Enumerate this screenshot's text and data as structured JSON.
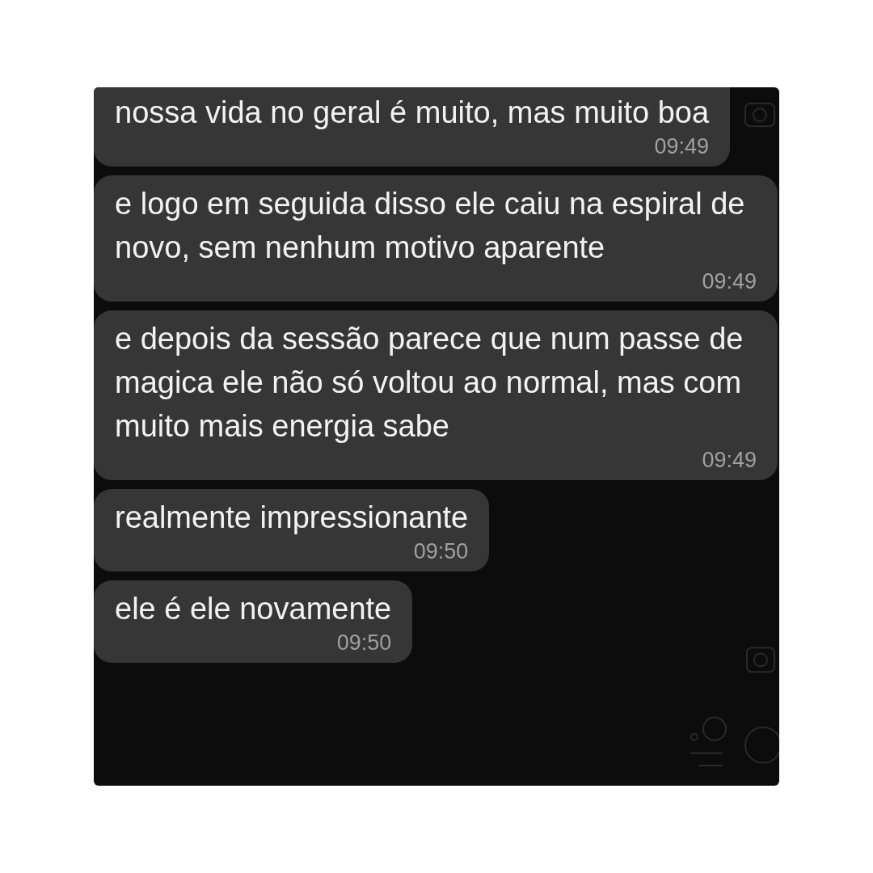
{
  "messages": [
    {
      "text": "nossa vida no geral é muito, mas muito boa",
      "time": "09:49"
    },
    {
      "text": "e logo em seguida disso ele caiu na espiral de novo, sem nenhum motivo aparente",
      "time": "09:49"
    },
    {
      "text": "e depois da sessão parece que num passe de magica ele não só voltou ao normal, mas com muito mais energia sabe",
      "time": "09:49"
    },
    {
      "text": "realmente impressionante",
      "time": "09:50"
    },
    {
      "text": "ele é ele novamente",
      "time": "09:50"
    }
  ]
}
